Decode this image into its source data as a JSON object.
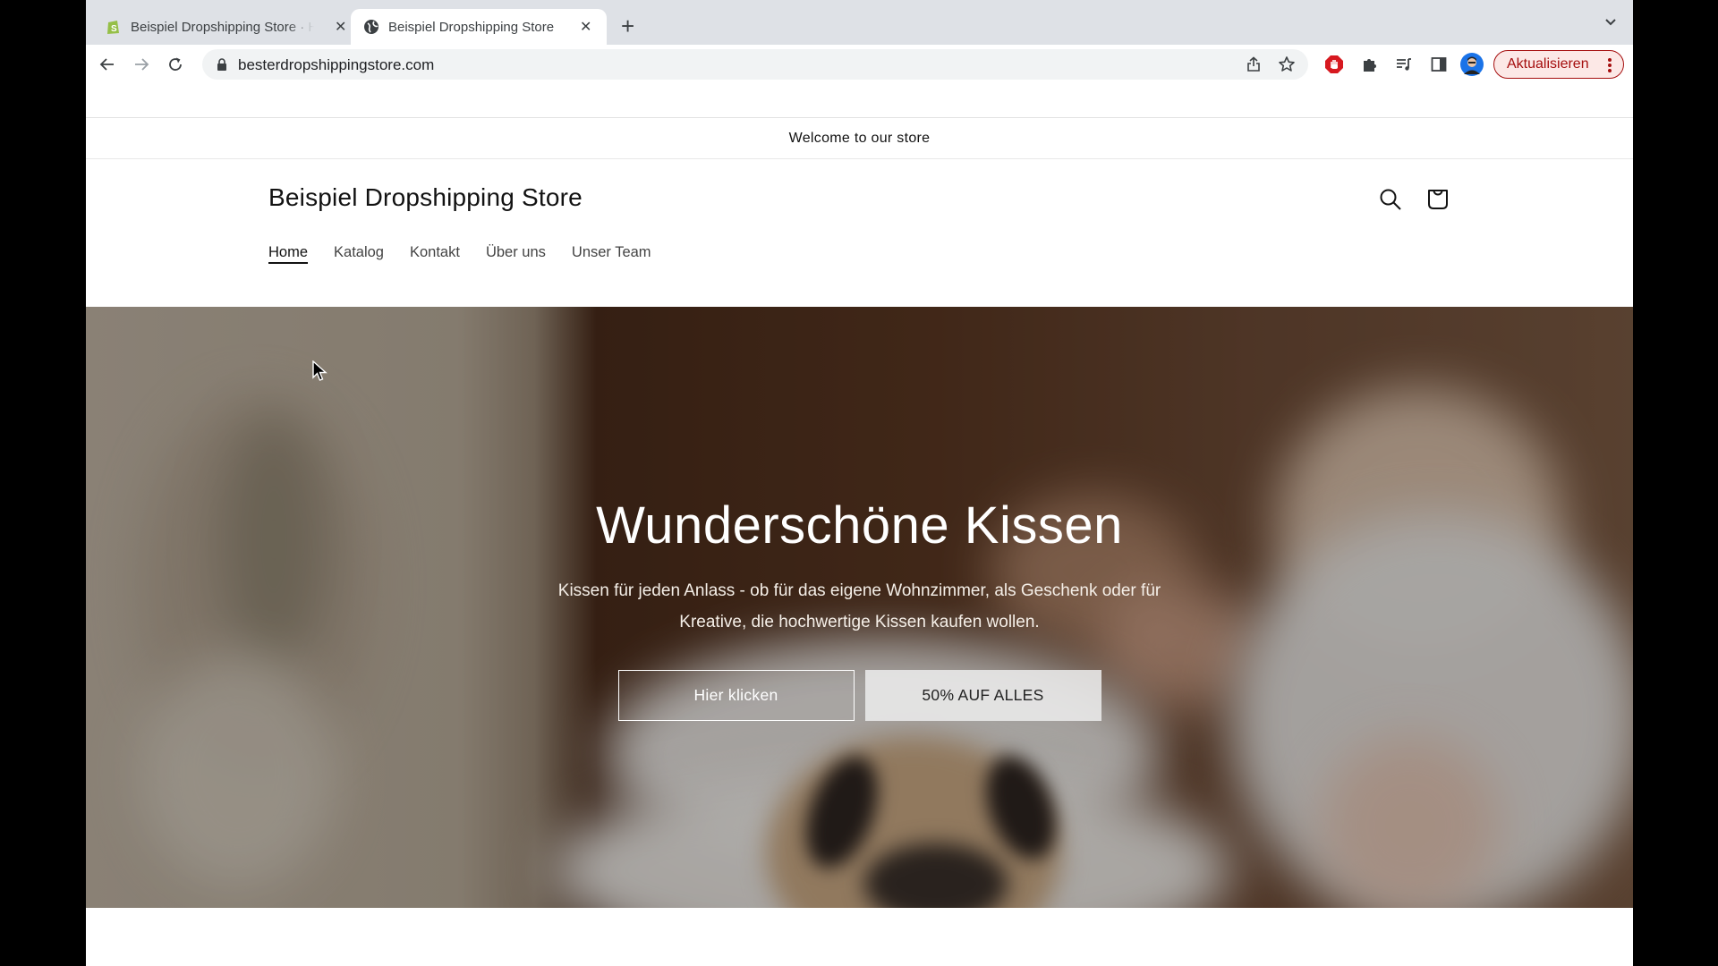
{
  "browser": {
    "tabs": [
      {
        "title": "Beispiel Dropshipping Store · Home · Shopify",
        "favicon": "shopify-icon",
        "active": false
      },
      {
        "title": "Beispiel Dropshipping Store",
        "favicon": "globe-icon",
        "active": true
      }
    ],
    "new_tab_label": "+",
    "url": "besterdropshippingstore.com",
    "update_button_label": "Aktualisieren",
    "colors": {
      "update_accent": "#a50e0e",
      "tabstrip": "#dee1e6"
    }
  },
  "store": {
    "announcement": "Welcome to our store",
    "name": "Beispiel Dropshipping Store",
    "nav": [
      {
        "label": "Home",
        "active": true
      },
      {
        "label": "Katalog",
        "active": false
      },
      {
        "label": "Kontakt",
        "active": false
      },
      {
        "label": "Über uns",
        "active": false
      },
      {
        "label": "Unser Team",
        "active": false
      }
    ],
    "hero": {
      "title": "Wunderschöne Kissen",
      "text": "Kissen für jeden Anlass - ob für das eigene Wohnzimmer, als Geschenk oder für Kreative, die hochwertige Kissen kaufen wollen.",
      "primary_button": "Hier klicken",
      "secondary_button": "50% AUF ALLES",
      "image_description": "Woman sleeping in bed with a pug dog"
    }
  }
}
